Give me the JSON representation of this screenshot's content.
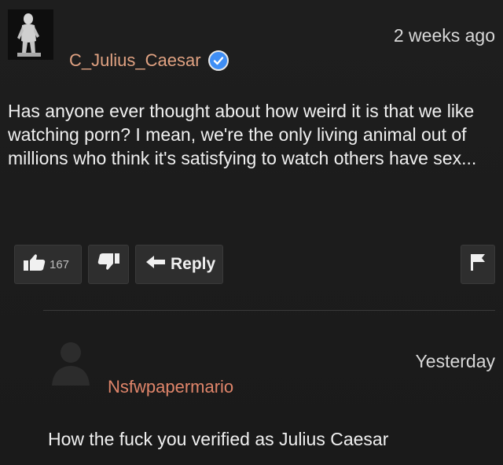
{
  "comment": {
    "username": "C_Julius_Caesar",
    "timestamp": "2 weeks ago",
    "verified": true,
    "text": "Has anyone ever thought about how weird it is that we like watching porn? I mean, we're the only living animal out of millions who think it's satisfying to watch others have sex...",
    "upvotes": "167",
    "reply_label": "Reply",
    "avatar_icon": "statue-avatar-icon",
    "username_color": "#e0a282"
  },
  "reply": {
    "username": "Nsfwpapermario",
    "timestamp": "Yesterday",
    "text": "How the fuck you verified as Julius Caesar",
    "avatar_icon": "default-user-avatar-icon",
    "username_color": "#e0856a"
  },
  "colors": {
    "background": "#1b1b1b",
    "verified_badge": "#3f8ef5",
    "button_bg": "#2e2e2e"
  }
}
